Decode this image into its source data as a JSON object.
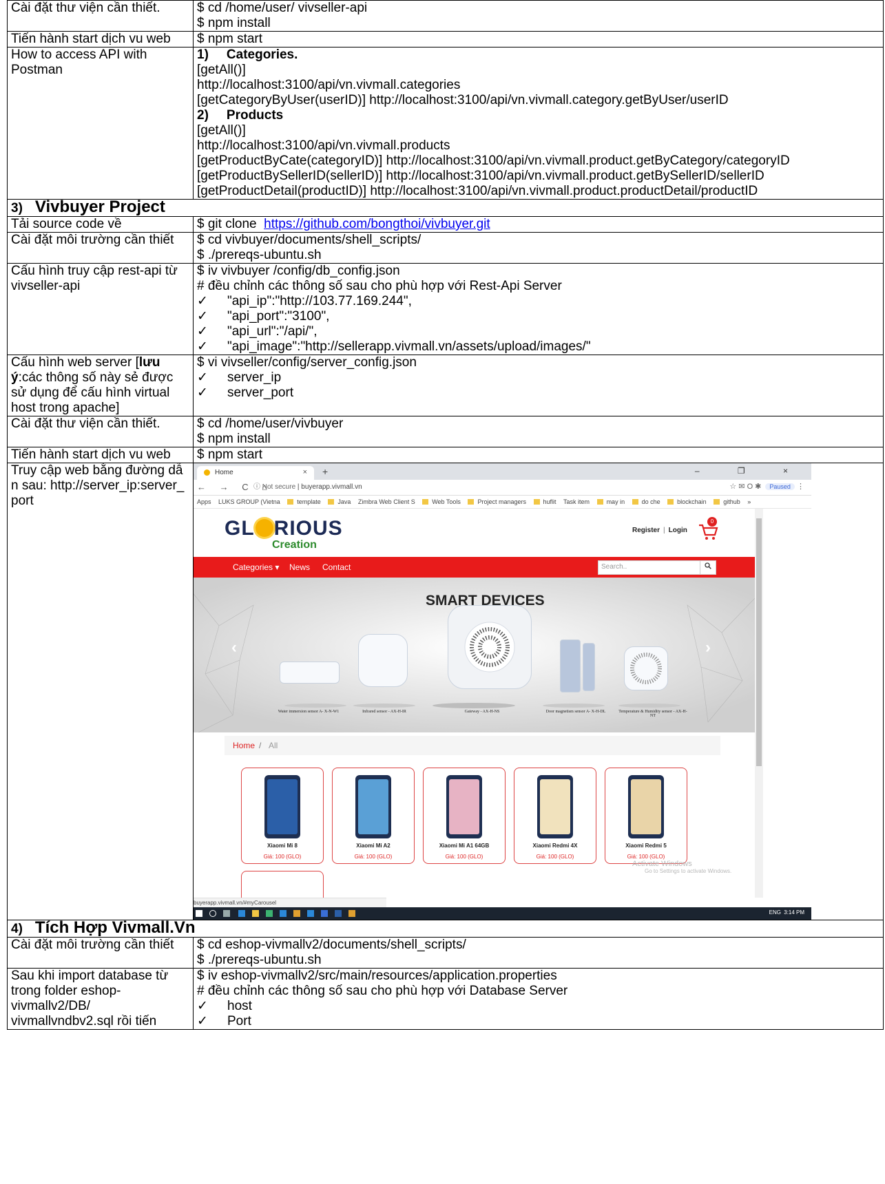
{
  "rows": {
    "r1": {
      "label": "Cài đặt thư viện cần thiết.",
      "lines": [
        "$ cd /home/user/ vivseller-api",
        "$ npm install"
      ]
    },
    "r2": {
      "label": "Tiến hành start dịch vu web",
      "lines": [
        "$ npm start"
      ]
    },
    "r3": {
      "label": "How to access API with Postman",
      "h1_num": "1)",
      "h1_text": "Categories.",
      "cat_lines": [
        "[getAll()]",
        "http://localhost:3100/api/vn.vivmall.categories",
        "[getCategoryByUser(userID)] http://localhost:3100/api/vn.vivmall.category.getByUser/userID"
      ],
      "h2_num": "2)",
      "h2_text": "Products",
      "prod_lines": [
        "[getAll()]",
        "http://localhost:3100/api/vn.vivmall.products",
        "[getProductByCate(categoryID)] http://localhost:3100/api/vn.vivmall.product.getByCategory/categoryID",
        "[getProductBySellerID(sellerID)] http://localhost:3100/api/vn.vivmall.product.getBySellerID/sellerID",
        "[getProductDetail(productID)] http://localhost:3100/api/vn.vivmall.product.productDetail/productID"
      ]
    },
    "s3": {
      "num": "3)",
      "title": "Vivbuyer  Project"
    },
    "r4": {
      "label": "Tải source code về",
      "prefix": "$ git clone  ",
      "link": "https://github.com/bongthoi/vivbuyer.git"
    },
    "r5": {
      "label": "Cài đặt môi trường cần thiết",
      "lines": [
        "$ cd  vivbuyer/documents/shell_scripts/",
        "$ ./prereqs-ubuntu.sh"
      ]
    },
    "r6": {
      "label": "Cấu hình truy cập rest-api từ vivseller-api",
      "lines": [
        "$ iv  vivbuyer /config/db_config.json",
        "# đều chỉnh các thông số sau cho phù hợp với Rest-Api Server"
      ],
      "checks": [
        "\"api_ip\":\"http://103.77.169.244\",",
        "\"api_port\":\"3100\",",
        "\"api_url\":\"/api/\",",
        "\"api_image\":\"http://sellerapp.vivmall.vn/assets/upload/images/\""
      ]
    },
    "r7": {
      "label_a": "Cấu hình web server [",
      "label_b": "lưu ý",
      "label_c": ":các thông số này sẻ được sử dụng để cấu hình virtual host trong apache]",
      "lines": [
        "$ vi vivseller/config/server_config.json"
      ],
      "checks": [
        "server_ip",
        "server_port"
      ]
    },
    "r8": {
      "label": "Cài đặt thư viện cần thiết.",
      "lines": [
        "$ cd /home/user/vivbuyer",
        "$ npm install"
      ]
    },
    "r9": {
      "label": "Tiến hành start dịch vu web",
      "lines": [
        "$ npm start"
      ]
    },
    "r10": {
      "label": "Truy cập web bằng đường dẫn sau: http://server_ip:server_port"
    },
    "s4": {
      "num": "4)",
      "title": "Tích Hợp Vivmall.Vn"
    },
    "r11": {
      "label": "Cài đặt môi trường cần thiết",
      "lines": [
        "$ cd  eshop-vivmallv2/documents/shell_scripts/",
        "$ ./prereqs-ubuntu.sh"
      ]
    },
    "r12": {
      "label": "Sau khi import database từ trong folder eshop-vivmallv2/DB/ vivmallvndbv2.sql rồi tiến",
      "lines": [
        "$ iv  eshop-vivmallv2/src/main/resources/application.properties",
        "# đều chỉnh các thông số sau cho phù hợp với Database Server"
      ],
      "checks": [
        "host",
        "Port"
      ]
    }
  },
  "check_mark": "✓",
  "browser": {
    "tab_title": "Home",
    "tab_close": "×",
    "new_tab": "+",
    "window_controls": "–  ❐  ×",
    "nav": "← → C ⌂",
    "not_secure": "ⓘ Not secure",
    "url": "buyerapp.vivmall.vn",
    "toolbar_icons": "☆ ✉ O ✱",
    "paused": "Paused",
    "menu_dots": "⋮",
    "bookmarks": [
      "Apps",
      "LUKS GROUP (Vietna",
      "template",
      "Java",
      "Zimbra Web Client S",
      "Web Tools",
      "Project managers",
      "huflit",
      "Task item",
      "may in",
      "do che",
      "blockchain",
      "github",
      "»"
    ],
    "status_url": "buyerapp.vivmall.vn/#myCarousel",
    "tray_lang": "ENG",
    "clock": "3:14 PM"
  },
  "site": {
    "logo_a": "GL",
    "logo_b": "RIOUS",
    "logo_sub": "Creation",
    "register": "Register",
    "divider": "|",
    "login": "Login",
    "cart_count": "0",
    "menu": {
      "categories": "Categories ▾",
      "news": "News",
      "contact": "Contact"
    },
    "search_placeholder": "Search..",
    "search_icon": "🔍",
    "hero_title": "SMART DEVICES",
    "arrow_prev": "‹",
    "arrow_next": "›",
    "devices": [
      "Water immersion sensor A- X-N-W1",
      "Infrared sensor - AX-H-IR",
      "Gateway - AX-H-NS",
      "Door magnetism sensor A- X-H-DL",
      "Temperature & Humidity sensor - AX-H-NT"
    ],
    "crumb_home": "Home",
    "crumb_sep": "/",
    "crumb_all": "All",
    "products": [
      {
        "name": "Xiaomi Mi 8",
        "price": "Giá: 100 (GLO)",
        "color": "#2b5fa8"
      },
      {
        "name": "Xiaomi Mi A2",
        "price": "Giá: 100 (GLO)",
        "color": "#5aa0d6"
      },
      {
        "name": "Xiaomi Mi A1 64GB",
        "price": "Giá: 100 (GLO)",
        "color": "#e7b3c4"
      },
      {
        "name": "Xiaomi Redmi 4X",
        "price": "Giá: 100 (GLO)",
        "color": "#f1e2bd"
      },
      {
        "name": "Xiaomi Redmi 5",
        "price": "Giá: 100 (GLO)",
        "color": "#e9d4a8"
      }
    ],
    "watermark_a": "Activate Windows",
    "watermark_b": "Go to Settings to activate Windows."
  }
}
